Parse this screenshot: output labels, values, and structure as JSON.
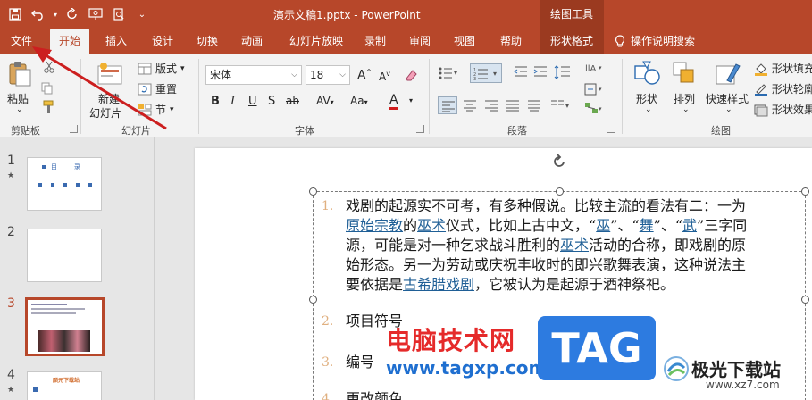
{
  "title_bar": {
    "doc_title": "演示文稿1.pptx  -  PowerPoint",
    "contextual_title": "绘图工具"
  },
  "tabs": [
    {
      "label": "文件"
    },
    {
      "label": "开始"
    },
    {
      "label": "插入"
    },
    {
      "label": "设计"
    },
    {
      "label": "切换"
    },
    {
      "label": "动画"
    },
    {
      "label": "幻灯片放映"
    },
    {
      "label": "录制"
    },
    {
      "label": "审阅"
    },
    {
      "label": "视图"
    },
    {
      "label": "帮助"
    },
    {
      "label": "形状格式"
    }
  ],
  "tell_me": "操作说明搜索",
  "ribbon": {
    "clipboard": {
      "paste": "粘贴",
      "group": "剪贴板"
    },
    "slides": {
      "new_slide_line1": "新建",
      "new_slide_line2": "幻灯片",
      "layout": "版式",
      "reset": "重置",
      "section": "节",
      "group": "幻灯片"
    },
    "font": {
      "font_name": "宋体",
      "font_size": "18",
      "group": "字体"
    },
    "paragraph": {
      "group": "段落"
    },
    "drawing": {
      "shapes": "形状",
      "arrange": "排列",
      "quick_styles": "快速样式",
      "fill": "形状填充",
      "outline": "形状轮廓",
      "effects": "形状效果",
      "group": "绘图"
    }
  },
  "thumbnails": [
    {
      "number": "1",
      "title": "目    录"
    },
    {
      "number": "2"
    },
    {
      "number": "3"
    },
    {
      "number": "4",
      "title": "颜元下载站"
    }
  ],
  "slide": {
    "items": [
      {
        "number": "1.",
        "line1": "戏剧的起源实不可考，有多种假说。比较主流的看法有二：一为",
        "line2_link1": "原始宗教",
        "line2_mid": "的",
        "line2_link2": "巫术",
        "line2_rest": "仪式，比如上古中文，“",
        "line2_link3": "巫",
        "line2_q1": "”、“",
        "line2_link4": "舞",
        "line2_q2": "”、“",
        "line2_link5": "武",
        "line2_end": "”三字同",
        "line3_pre": "源，可能是对一种乞求战斗胜利的",
        "line3_link": "巫术",
        "line3_post": "活动的合称，即戏剧的原",
        "line4": "始形态。另一为劳动或庆祝丰收时的即兴歌舞表演，这种说法主",
        "line5_pre": "要依据是",
        "line5_link": "古希腊戏剧",
        "line5_post": "，它被认为是起源于酒神祭祀。"
      },
      {
        "number": "2.",
        "text": "项目符号"
      },
      {
        "number": "3.",
        "text": "编号"
      },
      {
        "number": "4.",
        "text": "更改颜色"
      }
    ]
  },
  "watermark": {
    "cn": "电脑技术网",
    "url": "www.tagxp.com",
    "tag": "TAG",
    "site": "极光下载站",
    "site_url": "www.xz7.com"
  },
  "colors": {
    "accent": "#b7472a",
    "link": "#1f5f96",
    "arrow": "#cc1f1f"
  }
}
